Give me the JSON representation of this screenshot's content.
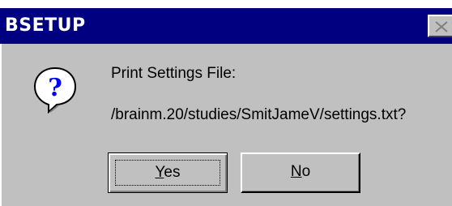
{
  "window": {
    "title": "BSETUP"
  },
  "message": {
    "line1": "Print Settings File:",
    "line2": "/brainm.20/studies/SmitJameV/settings.txt?"
  },
  "buttons": {
    "yes_mnemonic": "Y",
    "yes_rest": "es",
    "no_mnemonic": "N",
    "no_rest": "o"
  },
  "icons": {
    "dialog": "question-icon",
    "close": "close-icon"
  },
  "colors": {
    "titlebar": "#000080",
    "face": "#c0c0c0",
    "icon_fill": "#0000ff"
  }
}
